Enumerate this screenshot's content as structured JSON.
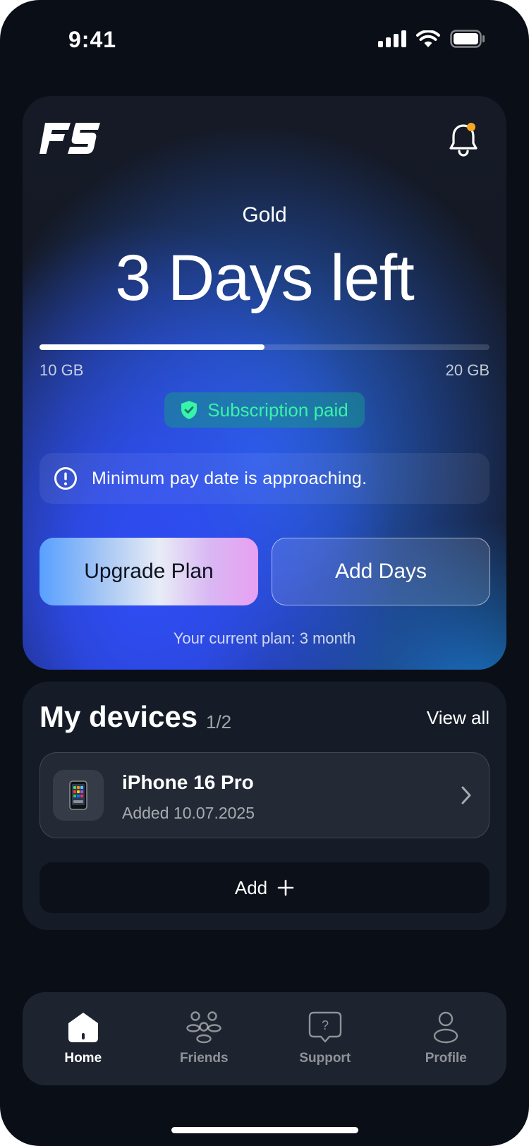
{
  "status_bar": {
    "time": "9:41"
  },
  "header": {
    "logo_text": "FS",
    "notification_dot_color": "#f5a623"
  },
  "subscription": {
    "plan_tier": "Gold",
    "days_left": "3 Days left",
    "usage_min": "10 GB",
    "usage_max": "20 GB",
    "usage_progress": 0.5,
    "status_badge": "Subscription paid",
    "notice": "Minimum pay date is approaching.",
    "upgrade_button": "Upgrade Plan",
    "add_days_button": "Add Days",
    "current_plan": "Your current plan: 3 month"
  },
  "devices": {
    "title": "My devices",
    "count": "1/2",
    "view_all": "View all",
    "items": [
      {
        "name": "iPhone 16 Pro",
        "added": "Added 10.07.2025",
        "icon": "smartphone-icon"
      }
    ],
    "add_button": "Add"
  },
  "tabbar": {
    "items": [
      {
        "label": "Home",
        "icon": "home-icon",
        "active": true
      },
      {
        "label": "Friends",
        "icon": "friends-icon",
        "active": false
      },
      {
        "label": "Support",
        "icon": "support-icon",
        "active": false
      },
      {
        "label": "Profile",
        "icon": "profile-icon",
        "active": false
      }
    ]
  },
  "colors": {
    "background": "#0a0e16",
    "card": "#161c27",
    "accent_blue": "#2f4cf5",
    "success_green": "#38f3a8"
  }
}
